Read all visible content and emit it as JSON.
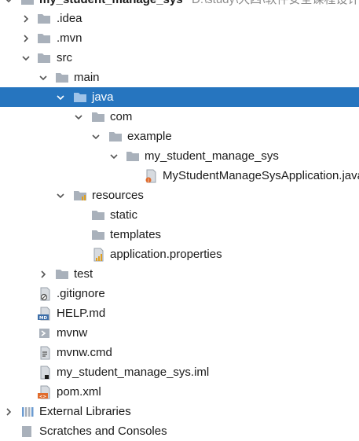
{
  "project": {
    "name": "my_student_manage_sys",
    "path": "D:\\study\\大四\\软件安全课程设计"
  },
  "tree": [
    {
      "label": ".idea",
      "type": "folder",
      "level": 1,
      "expanded": false
    },
    {
      "label": ".mvn",
      "type": "folder",
      "level": 1,
      "expanded": false
    },
    {
      "label": "src",
      "type": "folder",
      "level": 1,
      "expanded": true
    },
    {
      "label": "main",
      "type": "folder",
      "level": 2,
      "expanded": true
    },
    {
      "label": "java",
      "type": "folder-source",
      "level": 3,
      "expanded": true,
      "selected": true
    },
    {
      "label": "com",
      "type": "folder",
      "level": 4,
      "expanded": true
    },
    {
      "label": "example",
      "type": "folder",
      "level": 5,
      "expanded": true
    },
    {
      "label": "my_student_manage_sys",
      "type": "folder",
      "level": 6,
      "expanded": true
    },
    {
      "label": "MyStudentManageSysApplication.java",
      "type": "java-class",
      "level": 7
    },
    {
      "label": "resources",
      "type": "folder-resources",
      "level": 3,
      "expanded": true
    },
    {
      "label": "static",
      "type": "folder",
      "level": 4
    },
    {
      "label": "templates",
      "type": "folder",
      "level": 4
    },
    {
      "label": "application.properties",
      "type": "properties-file",
      "level": 4
    },
    {
      "label": "test",
      "type": "folder",
      "level": 2,
      "expanded": false
    },
    {
      "label": ".gitignore",
      "type": "gitignore-file",
      "level": 1
    },
    {
      "label": "HELP.md",
      "type": "markdown-file",
      "level": 1
    },
    {
      "label": "mvnw",
      "type": "shell-file",
      "level": 1
    },
    {
      "label": "mvnw.cmd",
      "type": "text-file",
      "level": 1
    },
    {
      "label": "my_student_manage_sys.iml",
      "type": "iml-file",
      "level": 1
    },
    {
      "label": "pom.xml",
      "type": "xml-file",
      "level": 1
    }
  ],
  "external_libraries": {
    "label": "External Libraries",
    "expanded": false
  },
  "scratches": {
    "label": "Scratches and Consoles"
  },
  "colors": {
    "selection": "#2675bf",
    "folder": "#a9b1bb",
    "text": "#1a1a1a"
  }
}
